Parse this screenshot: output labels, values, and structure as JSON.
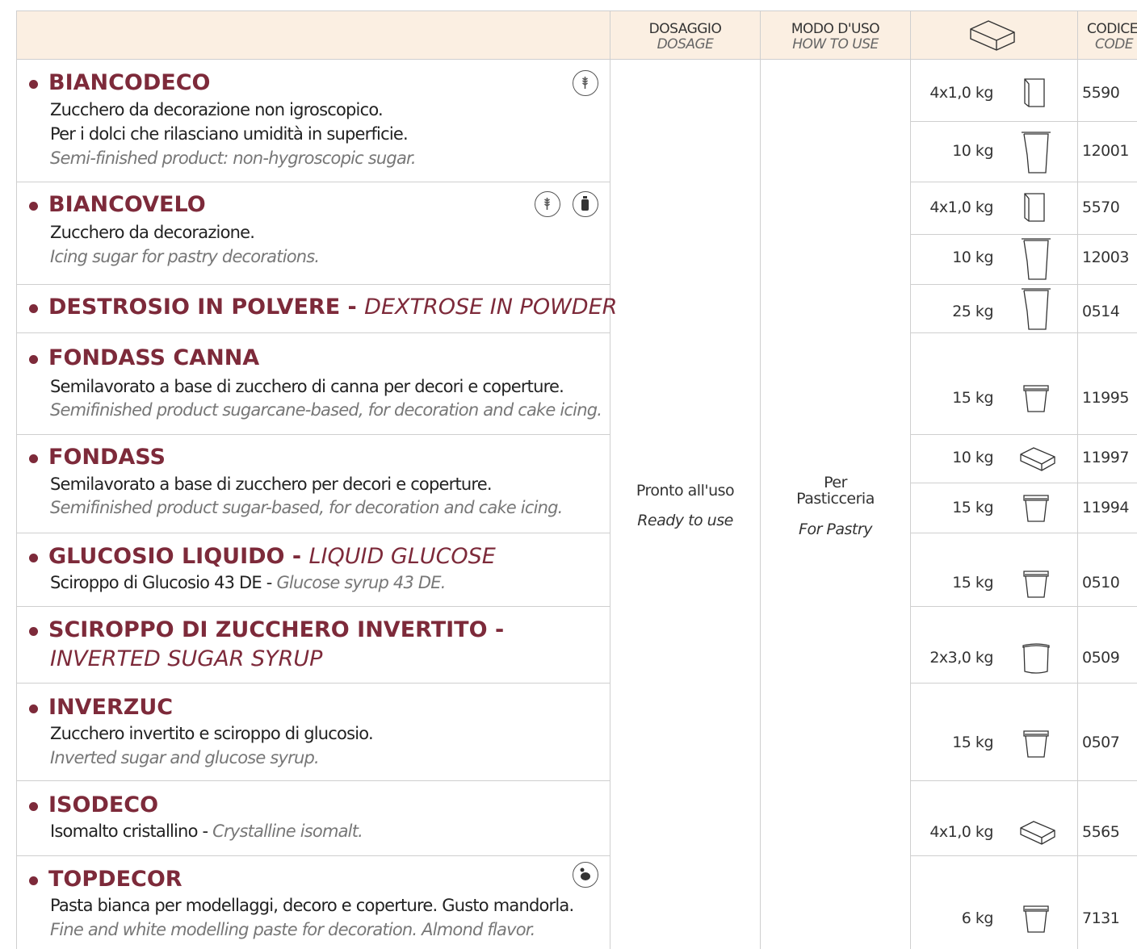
{
  "header": {
    "dosage_it": "DOSAGGIO",
    "dosage_en": "DOSAGE",
    "use_it": "MODO D'USO",
    "use_en": "HOW TO USE",
    "code_it": "CODICE",
    "code_en": "CODE"
  },
  "dosage": {
    "it": "Pronto all'uso",
    "en": "Ready to use"
  },
  "usage": {
    "it_line1": "Per",
    "it_line2": "Pasticceria",
    "en": "For Pastry"
  },
  "products": [
    {
      "name": "BIANCODECO",
      "line1": "Zucchero da decorazione non igroscopico.",
      "line2": "Per i dolci che rilasciano umidità in superficie.",
      "line3": "Semi-finished product: non-hygroscopic sugar."
    },
    {
      "name": "BIANCOVELO",
      "line1": "Zucchero da decorazione.",
      "line2": "Icing sugar for pastry decorations."
    },
    {
      "name": "DESTROSIO IN POLVERE - ",
      "name_en": "DEXTROSE IN POWDER"
    },
    {
      "name": "FONDASS CANNA",
      "line1": "Semilavorato a base di zucchero di canna per decori e coperture.",
      "line2": "Semifinished product sugarcane-based, for decoration and cake icing."
    },
    {
      "name": "FONDASS",
      "line1": "Semilavorato a base di zucchero per decori e coperture.",
      "line2": "Semifinished product sugar-based, for decoration and cake icing."
    },
    {
      "name": "GLUCOSIO LIQUIDO - ",
      "name_en": "LIQUID GLUCOSE",
      "line1": "Sciroppo di Glucosio 43 DE - ",
      "line1_en": "Glucose syrup 43 DE."
    },
    {
      "name": "SCIROPPO DI ZUCCHERO INVERTITO -",
      "name_en": "INVERTED SUGAR SYRUP"
    },
    {
      "name": "INVERZUC",
      "line1": "Zucchero invertito e sciroppo di glucosio.",
      "line2": "Inverted sugar and glucose syrup."
    },
    {
      "name": "ISODECO",
      "line1": "Isomalto cristallino - ",
      "line1_en": "Crystalline isomalt."
    },
    {
      "name": "TOPDECOR",
      "line1": "Pasta bianca per modellaggi, decoro e coperture. Gusto mandorla.",
      "line2": "Fine and white modelling paste for decoration. Almond flavor."
    }
  ],
  "packs": [
    {
      "weight": "4x1,0 kg",
      "code": "5590",
      "package": "bag-small-icon"
    },
    {
      "weight": "10 kg",
      "code": "12001",
      "package": "bag-large-icon"
    },
    {
      "weight": "4x1,0 kg",
      "code": "5570",
      "package": "bag-small-icon"
    },
    {
      "weight": "10 kg",
      "code": "12003",
      "package": "bag-large-icon"
    },
    {
      "weight": "25 kg",
      "code": "0514",
      "package": "bag-large-icon"
    },
    {
      "weight": "15 kg",
      "code": "11995",
      "package": "bucket-icon"
    },
    {
      "weight": "10 kg",
      "code": "11997",
      "package": "box-icon"
    },
    {
      "weight": "15 kg",
      "code": "11994",
      "package": "bucket-icon"
    },
    {
      "weight": "15 kg",
      "code": "0510",
      "package": "bucket-icon"
    },
    {
      "weight": "2x3,0 kg",
      "code": "0509",
      "package": "tub-icon"
    },
    {
      "weight": "15 kg",
      "code": "0507",
      "package": "bucket-icon"
    },
    {
      "weight": "4x1,0 kg",
      "code": "5565",
      "package": "box-icon"
    },
    {
      "weight": "6 kg",
      "code": "7131",
      "package": "bucket-icon"
    }
  ],
  "colors": {
    "brand": "#7d2a3a",
    "header_bg": "#fbefe2",
    "rule": "#cfcfcf"
  }
}
